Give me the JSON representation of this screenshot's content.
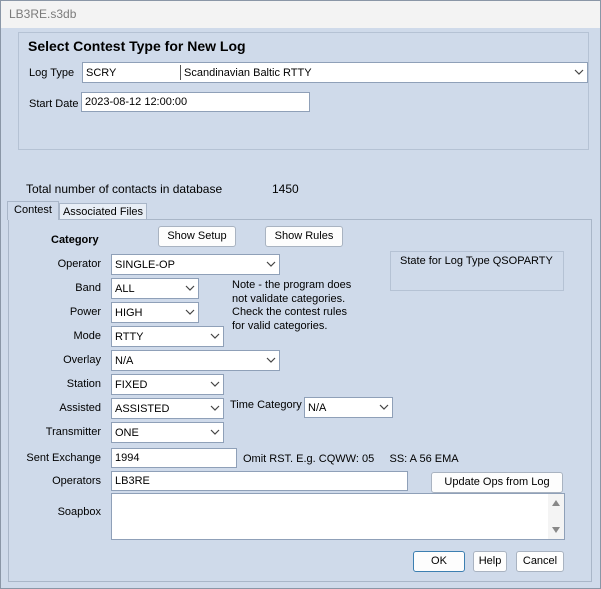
{
  "window": {
    "title": "LB3RE.s3db"
  },
  "header": {
    "heading": "Select Contest Type for New Log",
    "log_type_label": "Log Type",
    "log_type_code": "SCRY",
    "log_type_name": "Scandinavian Baltic RTTY",
    "start_date_label": "Start Date",
    "start_date_value": "2023-08-12 12:00:00"
  },
  "stats": {
    "label": "Total number of contacts in database",
    "count": "1450"
  },
  "tabs": [
    {
      "label": "Contest",
      "active": true
    },
    {
      "label": "Associated Files",
      "active": false
    }
  ],
  "contest": {
    "category_heading": "Category",
    "show_setup": "Show Setup",
    "show_rules": "Show Rules",
    "state_label": "State for Log Type QSOPARTY",
    "operator_label": "Operator",
    "operator_value": "SINGLE-OP",
    "band_label": "Band",
    "band_value": "ALL",
    "power_label": "Power",
    "power_value": "HIGH",
    "mode_label": "Mode",
    "mode_value": "RTTY",
    "overlay_label": "Overlay",
    "overlay_value": "N/A",
    "station_label": "Station",
    "station_value": "FIXED",
    "assisted_label": "Assisted",
    "assisted_value": "ASSISTED",
    "time_category_label": "Time Category",
    "time_category_value": "N/A",
    "transmitter_label": "Transmitter",
    "transmitter_value": "ONE",
    "note_lines": [
      "Note -  the program does",
      "not validate categories.",
      "Check the contest rules",
      "for valid categories."
    ],
    "sent_exchange_label": "Sent Exchange",
    "sent_exchange_value": "1994",
    "exchange_hint": "Omit RST. E.g. CQWW: 05     SS: A 56 EMA",
    "operators_label": "Operators",
    "operators_value": "LB3RE",
    "update_ops": "Update Ops from Log",
    "soapbox_label": "Soapbox",
    "soapbox_value": ""
  },
  "buttons": {
    "ok": "OK",
    "help": "Help",
    "cancel": "Cancel"
  },
  "icons": {
    "dropdown": "chevron-down-icon",
    "scroll_up": "scroll-up-arrow-icon",
    "scroll_down": "scroll-down-arrow-icon"
  },
  "colors": {
    "dialog_bg": "#cfdaea",
    "accent_border": "#3c7fb1"
  }
}
